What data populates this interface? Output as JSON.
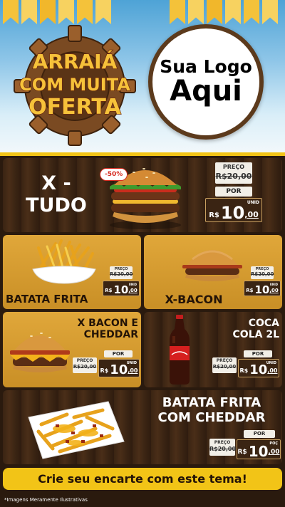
{
  "header": {
    "badge_lines": [
      "ARRAIÁ",
      "COM MUITA",
      "OFERTA"
    ],
    "logo_line1": "Sua Logo",
    "logo_line2": "Aqui"
  },
  "products": [
    {
      "name_lines": [
        "X -",
        "TUDO"
      ],
      "discount": "-50%",
      "preco_label": "PREÇO",
      "old_price": "R$20,00",
      "por_label": "POR",
      "currency": "R$",
      "price_int": "10",
      "price_dec": ",00",
      "unit": "UNID"
    },
    {
      "name": "BATATA FRITA",
      "preco_label": "PREÇO",
      "old_price": "R$20,00",
      "por_label": "POR",
      "currency": "R$",
      "price_int": "10",
      "price_dec": ",00",
      "unit": "UNID"
    },
    {
      "name": "X-BACON",
      "preco_label": "PREÇO",
      "old_price": "R$20,00",
      "por_label": "POR",
      "currency": "R$",
      "price_int": "10",
      "price_dec": ",00",
      "unit": "UNID"
    },
    {
      "name_lines": [
        "X BACON E",
        "CHEDDAR"
      ],
      "preco_label": "PREÇO",
      "old_price": "R$20,00",
      "por_label": "POR",
      "currency": "R$",
      "price_int": "10",
      "price_dec": ",00",
      "unit": "UNID"
    },
    {
      "name_lines": [
        "COCA",
        "COLA 2L"
      ],
      "preco_label": "PREÇO",
      "old_price": "R$20,00",
      "por_label": "POR",
      "currency": "R$",
      "price_int": "10",
      "price_dec": ",00",
      "unit": "UNID"
    },
    {
      "name_lines": [
        "BATATA FRITA",
        "COM CHEDDAR"
      ],
      "preco_label": "PREÇO",
      "old_price": "R$20,00",
      "por_label": "POR",
      "currency": "R$",
      "price_int": "10",
      "price_dec": ",00",
      "unit": "POÇ"
    }
  ],
  "cta": "Crie seu encarte com este tema!",
  "disclaimer": "*Imagens Meramente Ilustrativas",
  "colors": {
    "yellow": "#f2c417",
    "wood": "#3a2413",
    "gold": "#d59b30",
    "sky": "#8fc6e8"
  }
}
